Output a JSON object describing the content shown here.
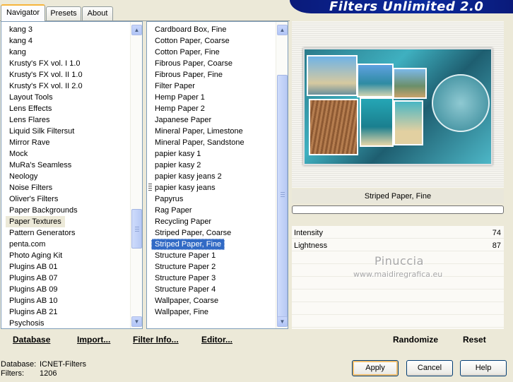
{
  "app": {
    "title": "Filters Unlimited 2.0"
  },
  "tabs": [
    {
      "label": "Navigator",
      "active": true
    },
    {
      "label": "Presets",
      "active": false
    },
    {
      "label": "About",
      "active": false
    }
  ],
  "category_list": {
    "items": [
      "kang 3",
      "kang 4",
      "kang",
      "Krusty's FX vol. I 1.0",
      "Krusty's FX vol. II 1.0",
      "Krusty's FX vol. II 2.0",
      "Layout Tools",
      "Lens Effects",
      "Lens Flares",
      "Liquid Silk Filtersut",
      "Mirror Rave",
      "Mock",
      "MuRa's Seamless",
      "Neology",
      "Noise Filters",
      "Oliver's Filters",
      "Paper Backgrounds",
      "Paper Textures",
      "Pattern Generators",
      "penta.com",
      "Photo Aging Kit",
      "Plugins AB 01",
      "Plugins AB 07",
      "Plugins AB 09",
      "Plugins AB 10",
      "Plugins AB 21",
      "Psychosis"
    ],
    "selected": "Paper Textures"
  },
  "filter_list": {
    "items": [
      "Cardboard Box, Fine",
      "Cotton Paper, Coarse",
      "Cotton Paper, Fine",
      "Fibrous Paper, Coarse",
      "Fibrous Paper, Fine",
      "Filter Paper",
      "Hemp Paper 1",
      "Hemp Paper 2",
      "Japanese Paper",
      "Mineral Paper, Limestone",
      "Mineral Paper, Sandstone",
      "papier kasy 1",
      "papier kasy 2",
      "papier kasy jeans 2",
      "papier kasy jeans",
      "Papyrus",
      "Rag Paper",
      "Recycling Paper",
      "Striped Paper, Coarse",
      "Striped Paper, Fine",
      "Structure Paper 1",
      "Structure Paper 2",
      "Structure Paper 3",
      "Structure Paper 4",
      "Wallpaper, Coarse",
      "Wallpaper, Fine"
    ],
    "selected": "Striped Paper, Fine"
  },
  "bottom_links": {
    "database": "Database",
    "import": "Import...",
    "filter_info": "Filter Info...",
    "editor": "Editor..."
  },
  "preview": {
    "filter_name": "Striped Paper, Fine",
    "progress_fraction": 0
  },
  "params": [
    {
      "label": "Intensity",
      "value": "74"
    },
    {
      "label": "Lightness",
      "value": "87"
    }
  ],
  "watermark": {
    "line1": "Pinuccia",
    "line2": "www.maidiregrafica.eu"
  },
  "right_buttons": {
    "randomize": "Randomize",
    "reset": "Reset"
  },
  "status": {
    "database_label": "Database:",
    "database_value": "ICNET-Filters",
    "filters_label": "Filters:",
    "filters_value": "1206"
  },
  "dialog_buttons": {
    "apply": "Apply",
    "cancel": "Cancel",
    "help": "Help"
  },
  "colors": {
    "accent_selection": "#316ac5",
    "header_blue": "#0b2a9c",
    "face": "#ece9d8"
  }
}
